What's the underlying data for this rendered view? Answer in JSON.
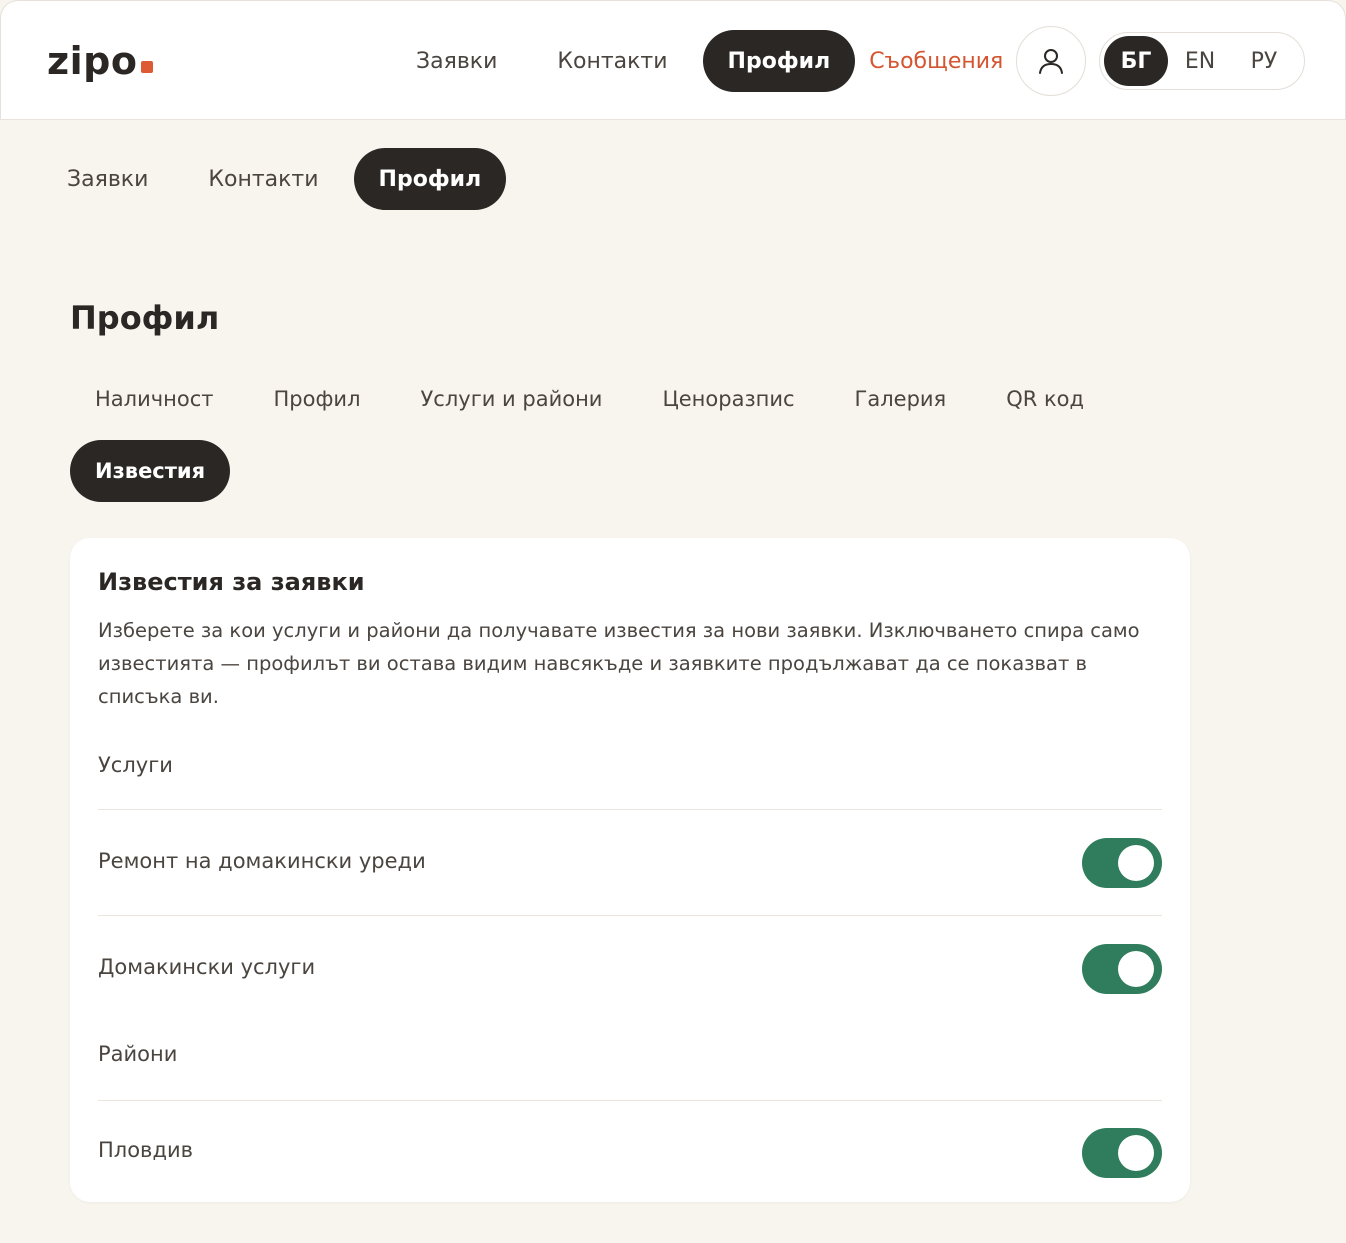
{
  "header": {
    "logo": "zipo",
    "nav": [
      "Заявки",
      "Контакти",
      "Профил",
      "Съобщения"
    ],
    "active_nav": "Профил",
    "languages": [
      "БГ",
      "EN",
      "РУ"
    ],
    "active_language": "БГ"
  },
  "subnav": {
    "items": [
      "Заявки",
      "Контакти",
      "Профил"
    ]
  },
  "page": {
    "title": "Профил",
    "tabs": [
      "Наличност",
      "Профил",
      "Услуги и райони",
      "Ценоразпис",
      "Галерия",
      "QR код",
      "Известия"
    ],
    "active_tab": "Известия"
  },
  "card": {
    "title": "Известия за заявки",
    "description": "Изберете за кои услуги и райони да получавате известия за нови заявки. Изключването спира само известията — профилът ви остава видим навсякъде и заявките продължават да се показват в списъка ви.",
    "services_label": "Услуги",
    "services": [
      {
        "name": "Ремонт на домакински уреди",
        "enabled": true
      },
      {
        "name": "Домакински услуги",
        "enabled": true
      }
    ],
    "regions_label": "Райони",
    "regions": [
      {
        "name": "Пловдив",
        "enabled": true
      }
    ]
  },
  "colors": {
    "accent": "#d4552f",
    "toggle_on": "#2f7d5c",
    "dark": "#2b2724",
    "background": "#f8f4ee"
  }
}
